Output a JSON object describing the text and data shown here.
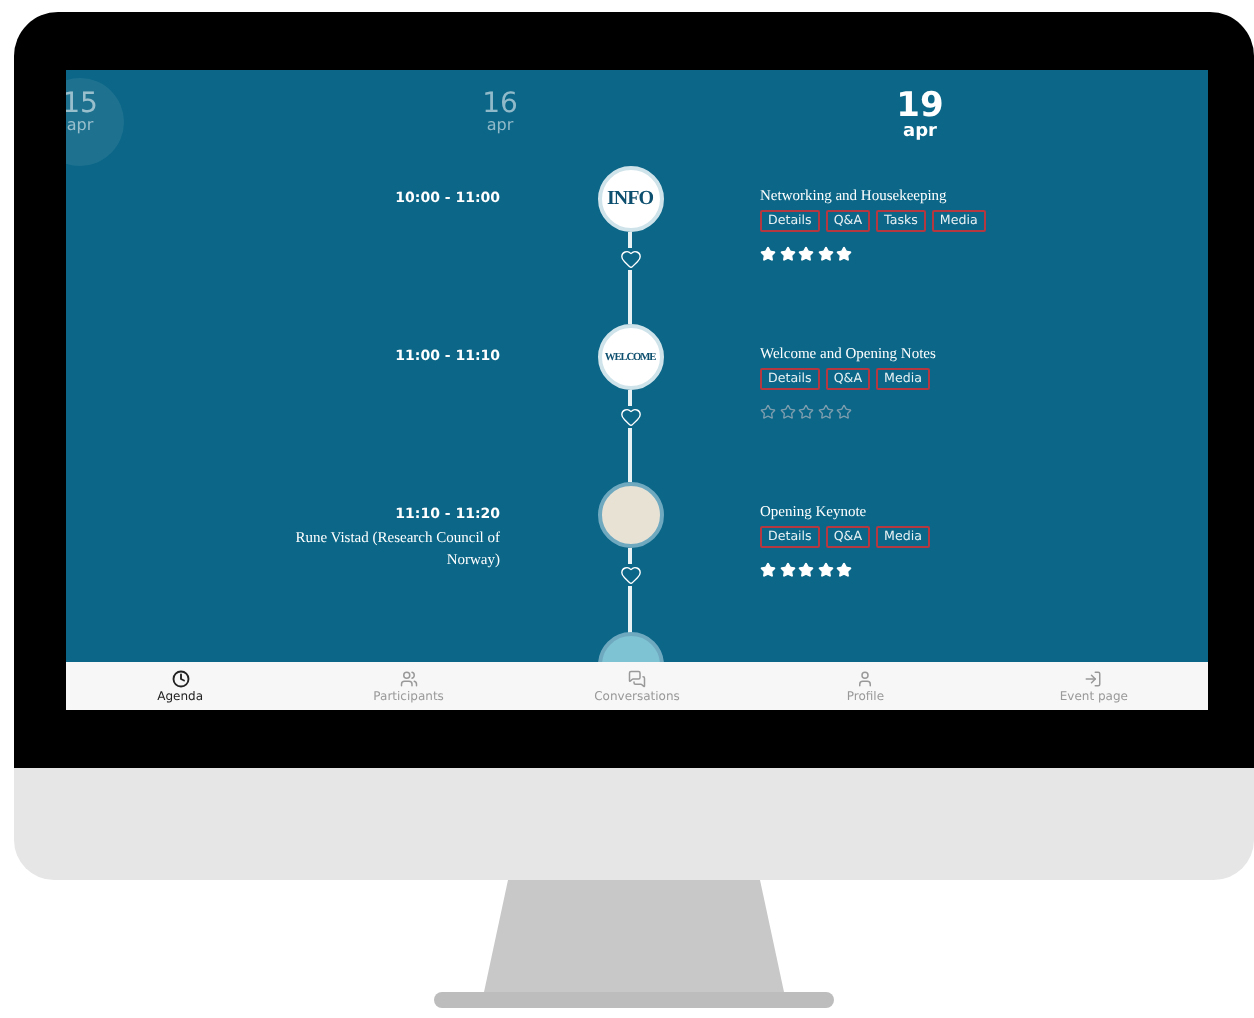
{
  "dates": [
    {
      "day": "15",
      "month": "apr",
      "selected": false,
      "circled": true
    },
    {
      "day": "16",
      "month": "apr",
      "selected": false,
      "circled": false
    },
    {
      "day": "19",
      "month": "apr",
      "selected": true,
      "circled": false
    }
  ],
  "sessions": [
    {
      "time": "10:00 - 11:00",
      "title": "Networking and Housekeeping",
      "marker": {
        "kind": "logo",
        "text": "INFO"
      },
      "tags": [
        "Details",
        "Q&A",
        "Tasks",
        "Media"
      ],
      "stars": 5
    },
    {
      "time": "11:00 - 11:10",
      "title": "Welcome and Opening Notes",
      "marker": {
        "kind": "logo",
        "text": "WELCOME"
      },
      "tags": [
        "Details",
        "Q&A",
        "Media"
      ],
      "stars": 0
    },
    {
      "time": "11:10 - 11:20",
      "speaker": "Rune Vistad (Research Council of Norway)",
      "title": "Opening Keynote",
      "marker": {
        "kind": "photo"
      },
      "tags": [
        "Details",
        "Q&A",
        "Media"
      ],
      "stars": 5
    }
  ],
  "nav": [
    {
      "label": "Agenda",
      "selected": true
    },
    {
      "label": "Participants",
      "selected": false
    },
    {
      "label": "Conversations",
      "selected": false
    },
    {
      "label": "Profile",
      "selected": false
    },
    {
      "label": "Event page",
      "selected": false
    }
  ]
}
